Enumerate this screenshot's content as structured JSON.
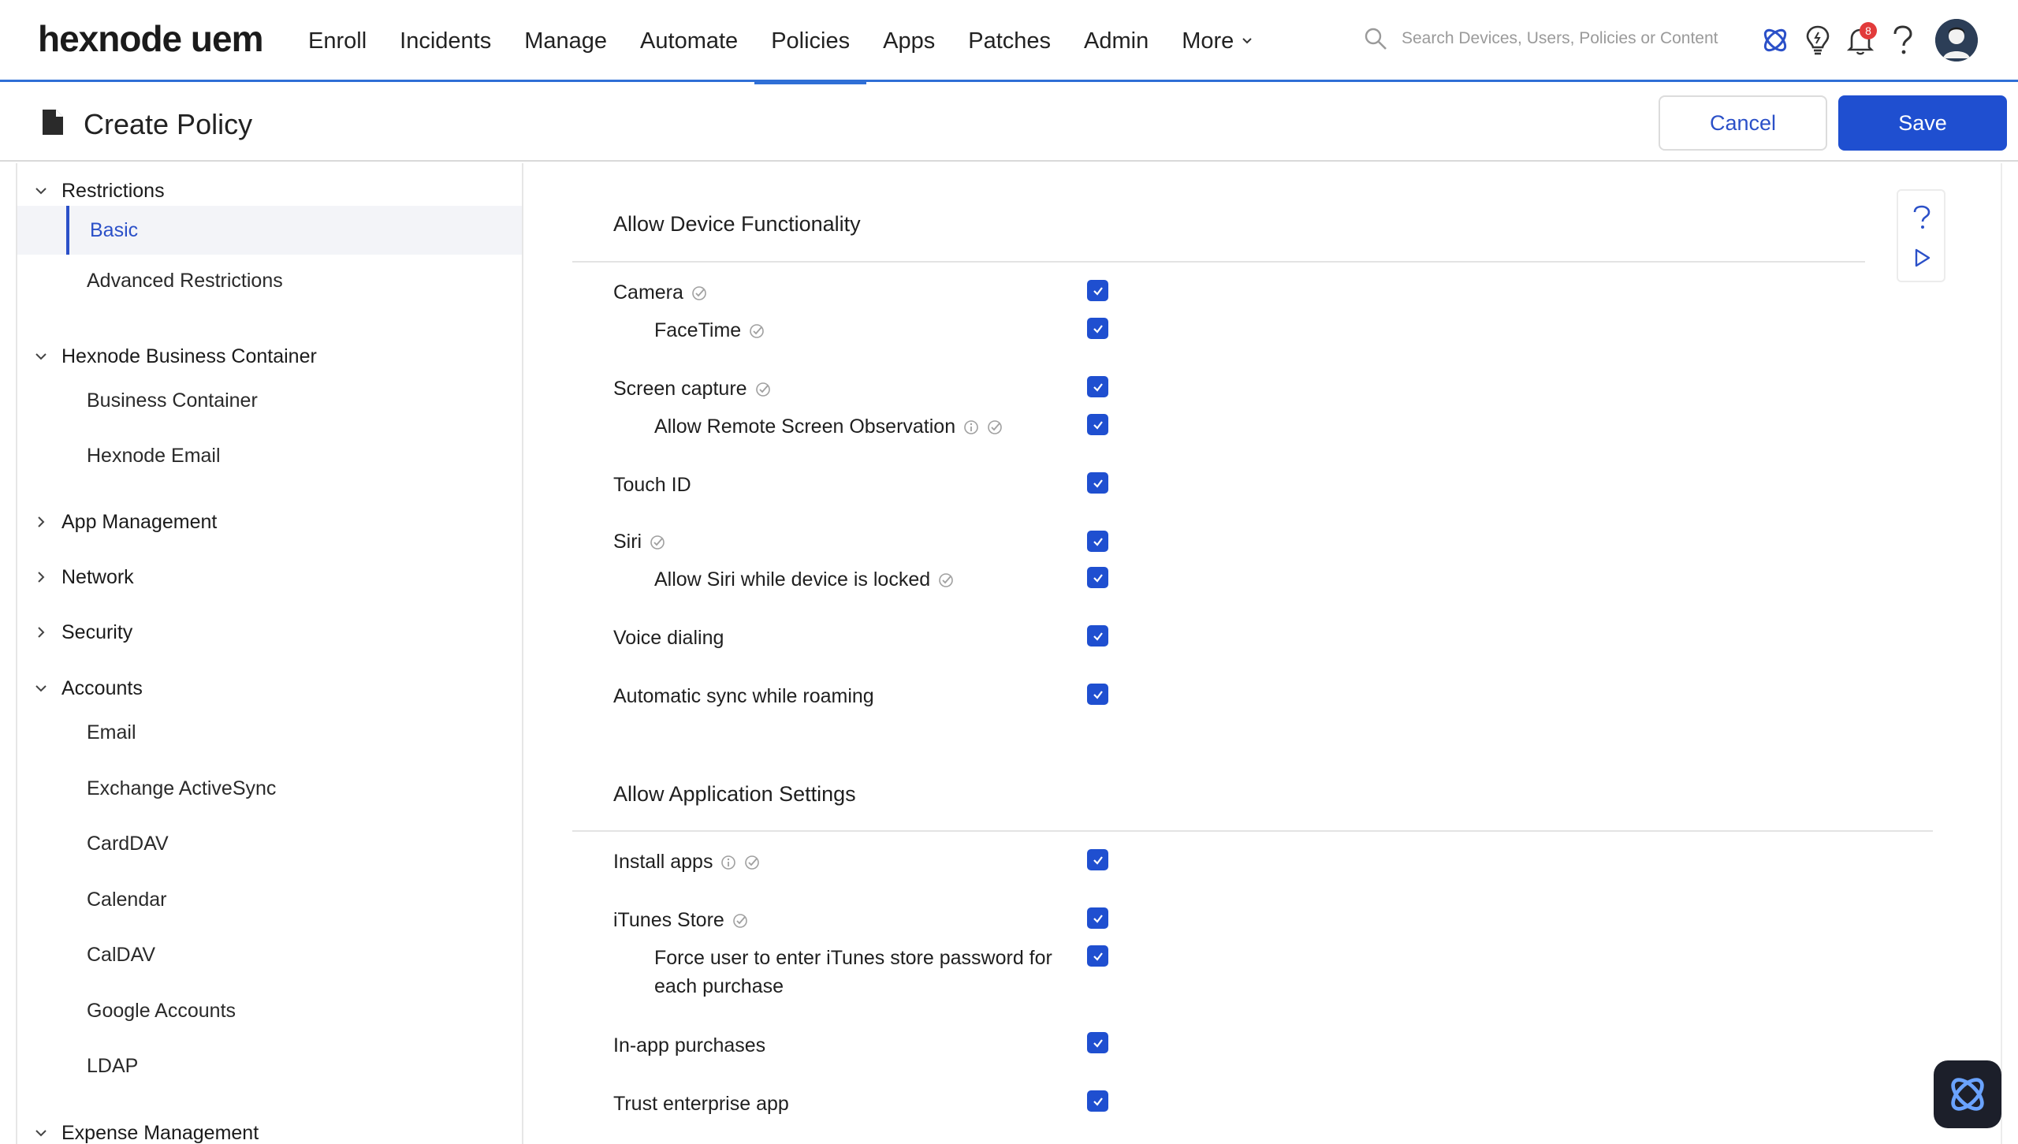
{
  "app": {
    "logo": "hexnode uem"
  },
  "nav": {
    "items": [
      "Enroll",
      "Incidents",
      "Manage",
      "Automate",
      "Policies",
      "Apps",
      "Patches",
      "Admin",
      "More"
    ],
    "active": "Policies",
    "search_placeholder": "Search Devices, Users, Policies or Content",
    "notification_count": "8",
    "accent_color": "#2f6fd6"
  },
  "header": {
    "title": "Create Policy",
    "cancel_label": "Cancel",
    "save_label": "Save"
  },
  "sidebar": {
    "restrictions": {
      "label": "Restrictions",
      "items": [
        "Basic",
        "Advanced Restrictions"
      ]
    },
    "business_container": {
      "label": "Hexnode Business Container",
      "items": [
        "Business Container",
        "Hexnode Email"
      ]
    },
    "app_management": {
      "label": "App Management"
    },
    "network": {
      "label": "Network"
    },
    "security": {
      "label": "Security"
    },
    "accounts": {
      "label": "Accounts",
      "items": [
        "Email",
        "Exchange ActiveSync",
        "CardDAV",
        "Calendar",
        "CalDAV",
        "Google Accounts",
        "LDAP"
      ]
    },
    "expense_management": {
      "label": "Expense Management"
    }
  },
  "main": {
    "device_section": {
      "title": "Allow Device Functionality",
      "options": [
        {
          "label": "Camera",
          "checked": true
        },
        {
          "label": "FaceTime",
          "checked": true
        },
        {
          "label": "Screen capture",
          "checked": true
        },
        {
          "label": "Allow Remote Screen Observation",
          "checked": true
        },
        {
          "label": "Touch ID",
          "checked": true
        },
        {
          "label": "Siri",
          "checked": true
        },
        {
          "label": "Allow Siri while device is locked",
          "checked": true
        },
        {
          "label": "Voice dialing",
          "checked": true
        },
        {
          "label": "Automatic sync while roaming",
          "checked": true
        }
      ]
    },
    "app_section": {
      "title": "Allow Application Settings",
      "options": [
        {
          "label": "Install apps",
          "checked": true
        },
        {
          "label": "iTunes Store",
          "checked": true
        },
        {
          "label": "Force user to enter iTunes store password for each purchase",
          "checked": true
        },
        {
          "label": "In-app purchases",
          "checked": true
        },
        {
          "label": "Trust enterprise app",
          "checked": true
        }
      ]
    }
  }
}
